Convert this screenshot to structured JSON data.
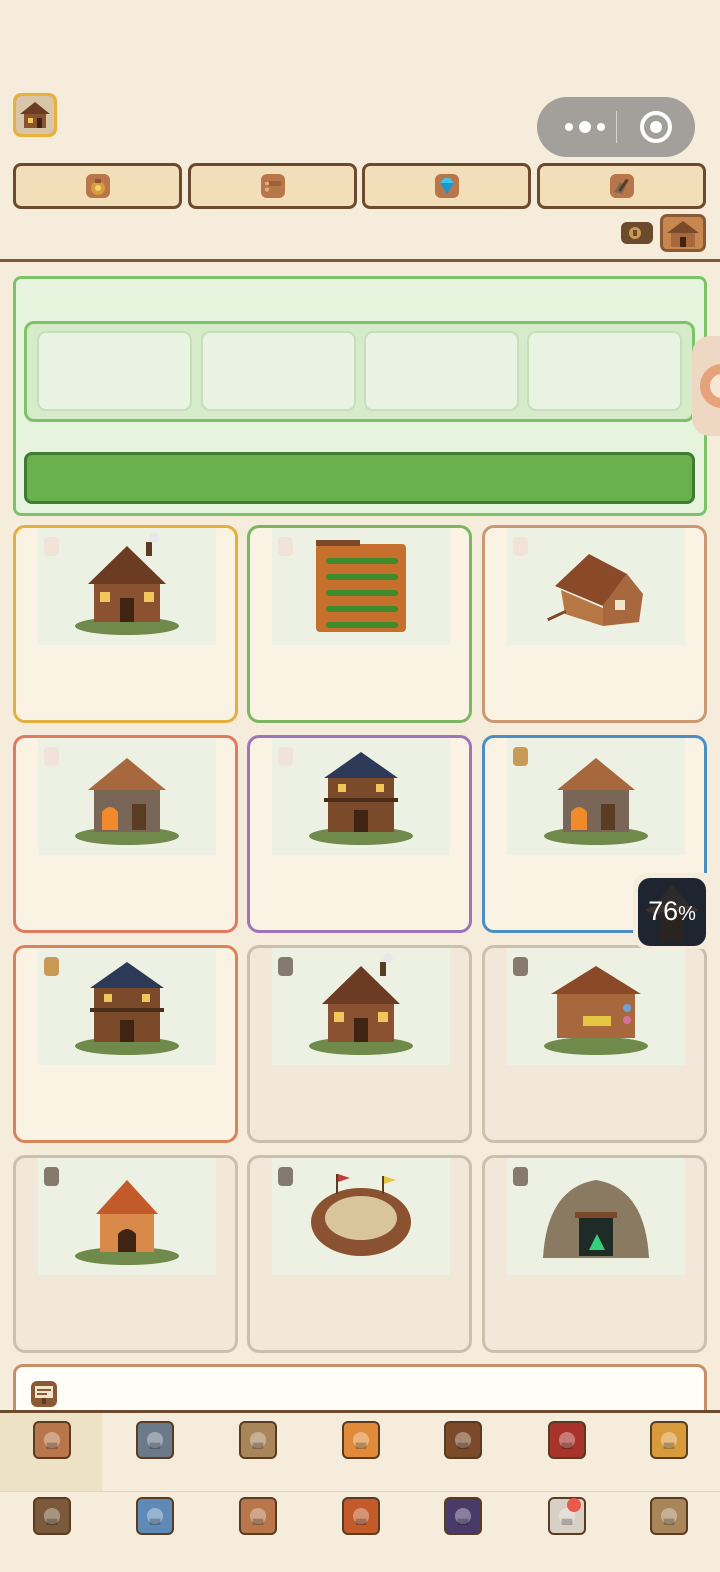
{
  "header": {
    "avatar_icon": "cabin-icon",
    "capsule": {
      "menu_icon": "more-dots-icon",
      "close_icon": "target-circle-icon"
    }
  },
  "resources": [
    {
      "icon": "gold-pouch-icon",
      "value": ""
    },
    {
      "icon": "wood-logs-icon",
      "value": ""
    },
    {
      "icon": "diamond-icon",
      "value": ""
    },
    {
      "icon": "ore-hammer-icon",
      "value": ""
    }
  ],
  "toolbar": {
    "settings_icon": "scroll-icon",
    "profile_icon": "house-icon"
  },
  "queue_panel": {
    "slots": [
      "",
      "",
      "",
      ""
    ],
    "action_label": ""
  },
  "buildings": [
    {
      "icon": "lodge-icon",
      "border": "#e3b03e",
      "tag": "light"
    },
    {
      "icon": "farm-field-icon",
      "border": "#7ab760",
      "tag": "light"
    },
    {
      "icon": "lumber-cabin-icon",
      "border": "#c99a72",
      "tag": "light"
    },
    {
      "icon": "forge-icon",
      "border": "#e07a60",
      "tag": "light"
    },
    {
      "icon": "tavern-icon",
      "border": "#9c74b8",
      "tag": "light"
    },
    {
      "icon": "forge-icon",
      "border": "#4c8ec2",
      "tag": "gold"
    },
    {
      "icon": "tavern-icon",
      "border": "#d98458",
      "tag": "gold"
    },
    {
      "icon": "lodge-icon",
      "border": "#cbbfae",
      "tag": "gray"
    },
    {
      "icon": "market-stall-icon",
      "border": "#cbbfae",
      "tag": "gray"
    },
    {
      "icon": "kennel-icon",
      "border": "#cbbfae",
      "tag": "gray"
    },
    {
      "icon": "arena-icon",
      "border": "#cbbfae",
      "tag": "gray"
    },
    {
      "icon": "mine-cave-icon",
      "border": "#cbbfae",
      "tag": "gray"
    }
  ],
  "floating": {
    "percent": "76",
    "unit": "%"
  },
  "notice": {
    "icon": "signboard-icon",
    "text": ""
  },
  "tabs_row1": [
    "home-icon",
    "knight-icon",
    "map-icon",
    "cat-icon",
    "backpack-icon",
    "banner-icon",
    "gold-pot-icon"
  ],
  "tabs_row2": [
    "ring-icon",
    "trophy-icon",
    "skull-scroll-icon",
    "lantern-icon",
    "portrait-icon",
    "seal-icon",
    "book-icon"
  ],
  "colors": {
    "background": "#f5ecdc",
    "accent_green": "#6ab04d",
    "wood": "#6b4a2e",
    "badge": "#ea5a4b"
  }
}
